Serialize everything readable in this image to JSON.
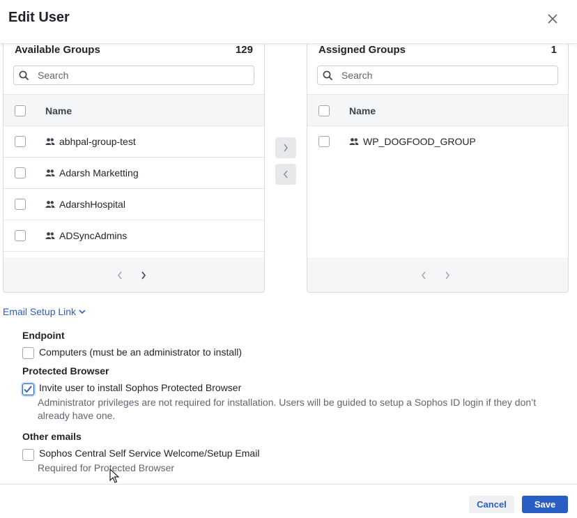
{
  "dialog": {
    "title": "Edit User",
    "close_icon": "close-icon"
  },
  "available": {
    "title": "Available Groups",
    "count": "129",
    "search_placeholder": "Search",
    "column_name": "Name",
    "rows": [
      {
        "label": "abhpal-group-test",
        "checked": false
      },
      {
        "label": "Adarsh Marketting",
        "checked": false
      },
      {
        "label": "AdarshHospital",
        "checked": false
      },
      {
        "label": "ADSyncAdmins",
        "checked": false
      }
    ]
  },
  "assigned": {
    "title": "Assigned Groups",
    "count": "1",
    "search_placeholder": "Search",
    "column_name": "Name",
    "rows": [
      {
        "label": "WP_DOGFOOD_GROUP",
        "checked": false
      }
    ]
  },
  "transfer": {
    "move_right_icon": "chevron-right-icon",
    "move_left_icon": "chevron-left-icon"
  },
  "email_setup": {
    "link_label": "Email Setup Link",
    "endpoint": {
      "heading": "Endpoint",
      "option_label": "Computers (must be an administrator to install)",
      "checked": false
    },
    "protected_browser": {
      "heading": "Protected Browser",
      "option_label": "Invite user to install Sophos Protected Browser",
      "description": "Administrator privileges are not required for installation. Users will be guided to setup a Sophos ID login if they don’t already have one.",
      "checked": true
    },
    "other_emails": {
      "heading": "Other emails",
      "option_label": "Sophos Central Self Service Welcome/Setup Email",
      "description": "Required for Protected Browser",
      "checked": false
    }
  },
  "footer": {
    "cancel_label": "Cancel",
    "save_label": "Save"
  },
  "colors": {
    "accent": "#2a5ec4",
    "panel_bg": "#f5f6f7",
    "border": "#d9dce0"
  }
}
